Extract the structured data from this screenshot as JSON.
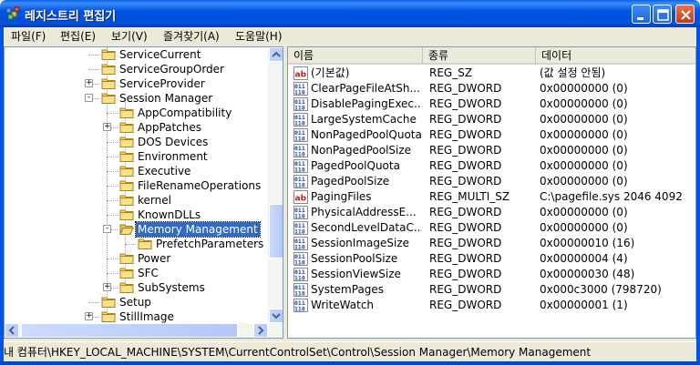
{
  "window": {
    "title": "레지스트리 편집기"
  },
  "menu": [
    "파일(F)",
    "편집(E)",
    "보기(V)",
    "즐겨찾기(A)",
    "도움말(H)"
  ],
  "tree": [
    {
      "label": "ServiceCurrent",
      "level": 0,
      "expander": ""
    },
    {
      "label": "ServiceGroupOrder",
      "level": 0,
      "expander": ""
    },
    {
      "label": "ServiceProvider",
      "level": 0,
      "expander": "+"
    },
    {
      "label": "Session Manager",
      "level": 0,
      "expander": "-"
    },
    {
      "label": "AppCompatibility",
      "level": 1,
      "expander": ""
    },
    {
      "label": "AppPatches",
      "level": 1,
      "expander": "+"
    },
    {
      "label": "DOS Devices",
      "level": 1,
      "expander": ""
    },
    {
      "label": "Environment",
      "level": 1,
      "expander": ""
    },
    {
      "label": "Executive",
      "level": 1,
      "expander": ""
    },
    {
      "label": "FileRenameOperations",
      "level": 1,
      "expander": ""
    },
    {
      "label": "kernel",
      "level": 1,
      "expander": ""
    },
    {
      "label": "KnownDLLs",
      "level": 1,
      "expander": ""
    },
    {
      "label": "Memory Management",
      "level": 1,
      "expander": "-",
      "selected": true
    },
    {
      "label": "PrefetchParameters",
      "level": 2,
      "expander": ""
    },
    {
      "label": "Power",
      "level": 1,
      "expander": ""
    },
    {
      "label": "SFC",
      "level": 1,
      "expander": ""
    },
    {
      "label": "SubSystems",
      "level": 1,
      "expander": "+"
    },
    {
      "label": "Setup",
      "level": 0,
      "expander": ""
    },
    {
      "label": "StillImage",
      "level": 0,
      "expander": "+"
    }
  ],
  "columns": {
    "name": "이름",
    "type": "종류",
    "data": "데이터"
  },
  "values": [
    {
      "icon": "string",
      "name": "(기본값)",
      "type": "REG_SZ",
      "data": "(값 설정 안됨)"
    },
    {
      "icon": "binary",
      "name": "ClearPageFileAtSh...",
      "type": "REG_DWORD",
      "data": "0x00000000 (0)"
    },
    {
      "icon": "binary",
      "name": "DisablePagingExec...",
      "type": "REG_DWORD",
      "data": "0x00000000 (0)"
    },
    {
      "icon": "binary",
      "name": "LargeSystemCache",
      "type": "REG_DWORD",
      "data": "0x00000000 (0)"
    },
    {
      "icon": "binary",
      "name": "NonPagedPoolQuota",
      "type": "REG_DWORD",
      "data": "0x00000000 (0)"
    },
    {
      "icon": "binary",
      "name": "NonPagedPoolSize",
      "type": "REG_DWORD",
      "data": "0x00000000 (0)"
    },
    {
      "icon": "binary",
      "name": "PagedPoolQuota",
      "type": "REG_DWORD",
      "data": "0x00000000 (0)"
    },
    {
      "icon": "binary",
      "name": "PagedPoolSize",
      "type": "REG_DWORD",
      "data": "0x00000000 (0)"
    },
    {
      "icon": "string",
      "name": "PagingFiles",
      "type": "REG_MULTI_SZ",
      "data": "C:\\pagefile.sys 2046 4092"
    },
    {
      "icon": "binary",
      "name": "PhysicalAddressE...",
      "type": "REG_DWORD",
      "data": "0x00000000 (0)"
    },
    {
      "icon": "binary",
      "name": "SecondLevelDataC...",
      "type": "REG_DWORD",
      "data": "0x00000000 (0)"
    },
    {
      "icon": "binary",
      "name": "SessionImageSize",
      "type": "REG_DWORD",
      "data": "0x00000010 (16)"
    },
    {
      "icon": "binary",
      "name": "SessionPoolSize",
      "type": "REG_DWORD",
      "data": "0x00000004 (4)"
    },
    {
      "icon": "binary",
      "name": "SessionViewSize",
      "type": "REG_DWORD",
      "data": "0x00000030 (48)"
    },
    {
      "icon": "binary",
      "name": "SystemPages",
      "type": "REG_DWORD",
      "data": "0x000c3000 (798720)"
    },
    {
      "icon": "binary",
      "name": "WriteWatch",
      "type": "REG_DWORD",
      "data": "0x00000001 (1)"
    }
  ],
  "statusbar": "내 컴퓨터\\HKEY_LOCAL_MACHINE\\SYSTEM\\CurrentControlSet\\Control\\Session Manager\\Memory Management",
  "colors": {
    "titlebar": "#0054E3",
    "selection": "#316AC5",
    "background": "#ECE9D8"
  }
}
